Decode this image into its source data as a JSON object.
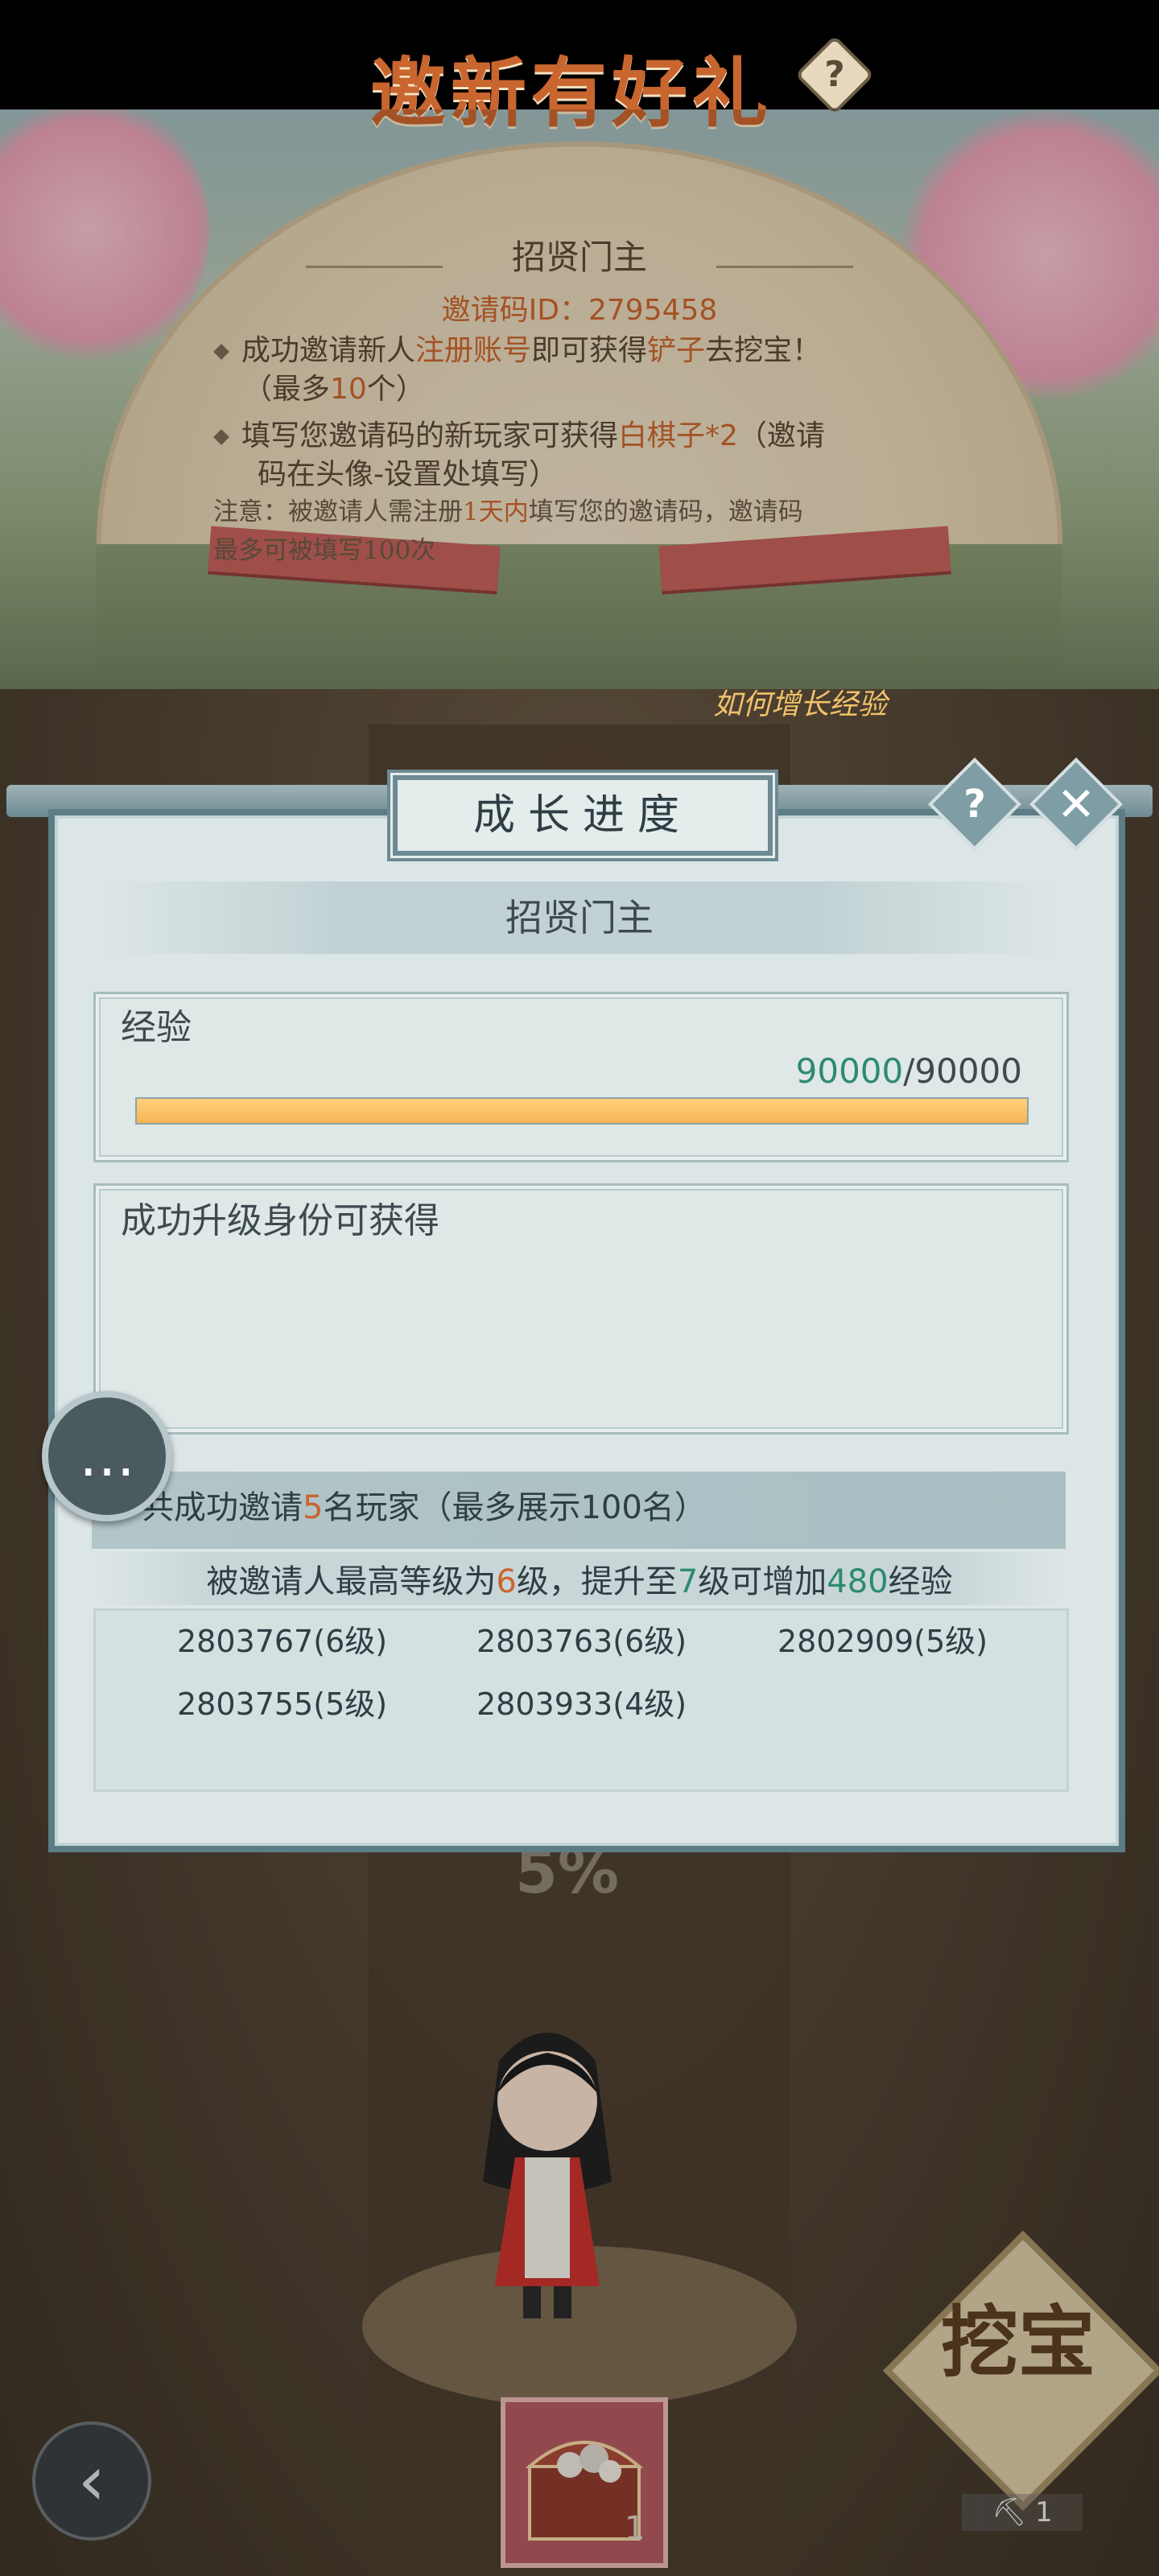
{
  "banner": {
    "title": "邀新有好礼",
    "subtitle": "招贤门主",
    "invite_code": "邀请码ID：2795458",
    "rule1_prefix": "成功邀请新人",
    "rule1_hl1": "注册账号",
    "rule1_mid": "即可获得",
    "rule1_hl2": "铲子",
    "rule1_suffix": "去挖宝！",
    "rule1_line2_prefix": "（最多",
    "rule1_line2_hl": "10",
    "rule1_line2_suffix": "个）",
    "rule2_prefix": "填写您邀请码的新玩家可获得",
    "rule2_hl": "白棋子*2",
    "rule2_suffix": "（邀请",
    "rule2_line2": "码在头像-设置处填写）",
    "notice_prefix": "注意：被邀请人需注册",
    "notice_hl": "1天内",
    "notice_suffix": "填写您的邀请码，邀请码",
    "notice_line2": "最多可被填写100次"
  },
  "dialog": {
    "title": "成长进度",
    "help_hint": "如何增长经验",
    "rank_title": "招贤门主",
    "exp_label": "经验",
    "exp_current": "90000",
    "exp_total": "/90000",
    "exp_progress": 1.0,
    "reward_title": "成功升级身份可获得",
    "invite_prefix": "共成功邀请",
    "invite_count": "5",
    "invite_suffix": "名玩家（最多展示100名）",
    "level_prefix": "被邀请人最高等级为",
    "level_current": "6",
    "level_mid": "级，提升至",
    "level_target": "7",
    "level_mid2": "级可增加",
    "level_exp": "480",
    "level_suffix": "经验",
    "players": [
      "2803767(6级)",
      "2803763(6级)",
      "2802909(5级)",
      "2803755(5级)",
      "2803933(4级)"
    ]
  },
  "game": {
    "percent": "5%",
    "chest_count": "1",
    "dig_label": "挖宝",
    "shovel_count": "1"
  },
  "icons": {
    "help": "question-icon",
    "close": "close-icon",
    "chat": "chat-icon",
    "back": "back-arrow-icon",
    "chest": "treasure-chest-icon",
    "shovel": "shovel-icon"
  }
}
